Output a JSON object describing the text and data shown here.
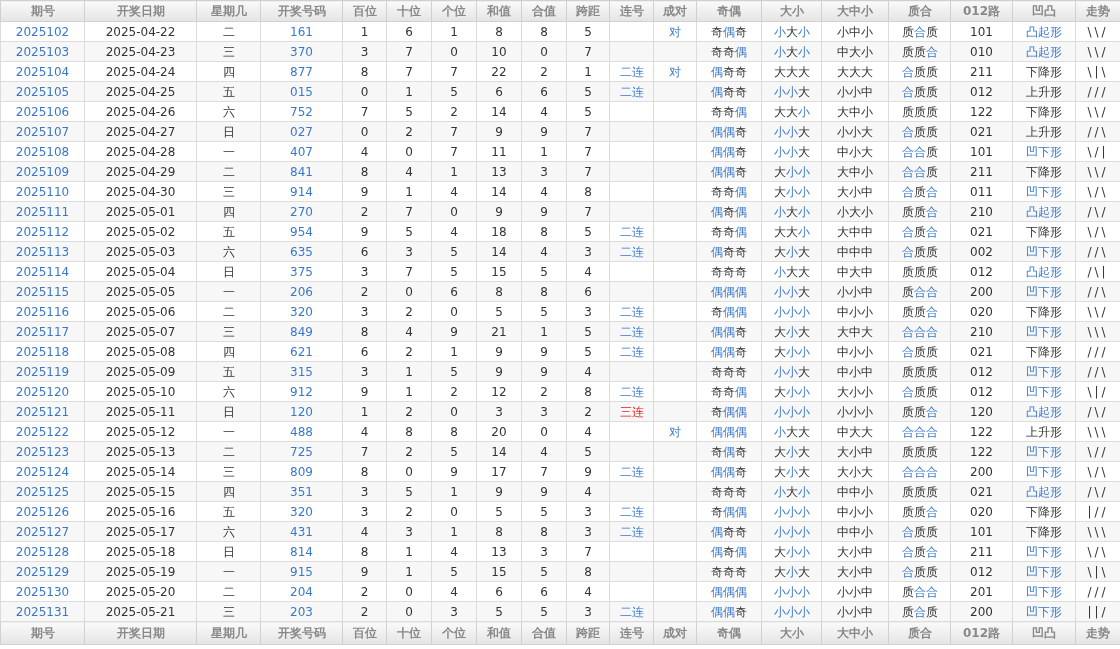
{
  "columns": [
    "期号",
    "开奖日期",
    "星期几",
    "开奖号码",
    "百位",
    "十位",
    "个位",
    "和值",
    "合值",
    "跨距",
    "连号",
    "成对",
    "奇偶",
    "大小",
    "大中小",
    "质合",
    "012路",
    "凹凸",
    "走势"
  ],
  "rows": [
    {
      "issue": "2025102",
      "date": "2025-04-22",
      "weekday": "二",
      "number": "161",
      "digits": [
        "1",
        "6",
        "1",
        "8",
        "8",
        "5"
      ],
      "pair": "对",
      "parity": "奇偶奇",
      "parity_hl": [
        false,
        true,
        false
      ],
      "size": "小大小",
      "size_hl": [
        true,
        false,
        true
      ],
      "size3": "小中小",
      "prime": "质合质",
      "prime_hl": [
        false,
        true,
        false
      ],
      "road": "101",
      "shape": "凸起形",
      "shape_hl": true,
      "trend": "\\\\/"
    },
    {
      "issue": "2025103",
      "date": "2025-04-23",
      "weekday": "三",
      "number": "370",
      "digits": [
        "3",
        "7",
        "0",
        "10",
        "0",
        "7"
      ],
      "parity": "奇奇偶",
      "parity_hl": [
        false,
        false,
        true
      ],
      "size": "小大小",
      "size_hl": [
        true,
        false,
        true
      ],
      "size3": "中大小",
      "prime": "质质合",
      "prime_hl": [
        false,
        false,
        true
      ],
      "road": "010",
      "shape": "凸起形",
      "shape_hl": true,
      "trend": "\\\\/"
    },
    {
      "issue": "2025104",
      "date": "2025-04-24",
      "weekday": "四",
      "number": "877",
      "digits": [
        "8",
        "7",
        "7",
        "22",
        "2",
        "1"
      ],
      "consec": {
        "text": "二连",
        "kind": "double"
      },
      "pair": "对",
      "parity": "偶奇奇",
      "parity_hl": [
        true,
        false,
        false
      ],
      "size": "大大大",
      "size_hl": [
        false,
        false,
        false
      ],
      "size3": "大大大",
      "prime": "合质质",
      "prime_hl": [
        true,
        false,
        false
      ],
      "road": "211",
      "shape": "下降形",
      "shape_hl": false,
      "trend": "\\|\\"
    },
    {
      "issue": "2025105",
      "date": "2025-04-25",
      "weekday": "五",
      "number": "015",
      "digits": [
        "0",
        "1",
        "5",
        "6",
        "6",
        "5"
      ],
      "consec": {
        "text": "二连",
        "kind": "double"
      },
      "parity": "偶奇奇",
      "parity_hl": [
        true,
        false,
        false
      ],
      "size": "小小大",
      "size_hl": [
        true,
        true,
        false
      ],
      "size3": "小小中",
      "prime": "合质质",
      "prime_hl": [
        true,
        false,
        false
      ],
      "road": "012",
      "shape": "上升形",
      "shape_hl": false,
      "trend": "///"
    },
    {
      "issue": "2025106",
      "date": "2025-04-26",
      "weekday": "六",
      "number": "752",
      "digits": [
        "7",
        "5",
        "2",
        "14",
        "4",
        "5"
      ],
      "parity": "奇奇偶",
      "parity_hl": [
        false,
        false,
        true
      ],
      "size": "大大小",
      "size_hl": [
        false,
        false,
        true
      ],
      "size3": "大中小",
      "prime": "质质质",
      "prime_hl": [
        false,
        false,
        false
      ],
      "road": "122",
      "shape": "下降形",
      "shape_hl": false,
      "trend": "\\\\/"
    },
    {
      "issue": "2025107",
      "date": "2025-04-27",
      "weekday": "日",
      "number": "027",
      "digits": [
        "0",
        "2",
        "7",
        "9",
        "9",
        "7"
      ],
      "parity": "偶偶奇",
      "parity_hl": [
        true,
        true,
        false
      ],
      "size": "小小大",
      "size_hl": [
        true,
        true,
        false
      ],
      "size3": "小小大",
      "prime": "合质质",
      "prime_hl": [
        true,
        false,
        false
      ],
      "road": "021",
      "shape": "上升形",
      "shape_hl": false,
      "trend": "//\\"
    },
    {
      "issue": "2025108",
      "date": "2025-04-28",
      "weekday": "一",
      "number": "407",
      "digits": [
        "4",
        "0",
        "7",
        "11",
        "1",
        "7"
      ],
      "parity": "偶偶奇",
      "parity_hl": [
        true,
        true,
        false
      ],
      "size": "小小大",
      "size_hl": [
        true,
        true,
        false
      ],
      "size3": "中小大",
      "prime": "合合质",
      "prime_hl": [
        true,
        true,
        false
      ],
      "road": "101",
      "shape": "凹下形",
      "shape_hl": true,
      "trend": "\\/|"
    },
    {
      "issue": "2025109",
      "date": "2025-04-29",
      "weekday": "二",
      "number": "841",
      "digits": [
        "8",
        "4",
        "1",
        "13",
        "3",
        "7"
      ],
      "parity": "偶偶奇",
      "parity_hl": [
        true,
        true,
        false
      ],
      "size": "大小小",
      "size_hl": [
        false,
        true,
        true
      ],
      "size3": "大中小",
      "prime": "合合质",
      "prime_hl": [
        true,
        true,
        false
      ],
      "road": "211",
      "shape": "下降形",
      "shape_hl": false,
      "trend": "\\\\/"
    },
    {
      "issue": "2025110",
      "date": "2025-04-30",
      "weekday": "三",
      "number": "914",
      "digits": [
        "9",
        "1",
        "4",
        "14",
        "4",
        "8"
      ],
      "parity": "奇奇偶",
      "parity_hl": [
        false,
        false,
        true
      ],
      "size": "大小小",
      "size_hl": [
        false,
        true,
        true
      ],
      "size3": "大小中",
      "prime": "合质合",
      "prime_hl": [
        true,
        false,
        true
      ],
      "road": "011",
      "shape": "凹下形",
      "shape_hl": true,
      "trend": "\\/\\"
    },
    {
      "issue": "2025111",
      "date": "2025-05-01",
      "weekday": "四",
      "number": "270",
      "digits": [
        "2",
        "7",
        "0",
        "9",
        "9",
        "7"
      ],
      "parity": "偶奇偶",
      "parity_hl": [
        true,
        false,
        true
      ],
      "size": "小大小",
      "size_hl": [
        true,
        false,
        true
      ],
      "size3": "小大小",
      "prime": "质质合",
      "prime_hl": [
        false,
        false,
        true
      ],
      "road": "210",
      "shape": "凸起形",
      "shape_hl": true,
      "trend": "/\\/"
    },
    {
      "issue": "2025112",
      "date": "2025-05-02",
      "weekday": "五",
      "number": "954",
      "digits": [
        "9",
        "5",
        "4",
        "18",
        "8",
        "5"
      ],
      "consec": {
        "text": "二连",
        "kind": "double"
      },
      "parity": "奇奇偶",
      "parity_hl": [
        false,
        false,
        true
      ],
      "size": "大大小",
      "size_hl": [
        false,
        false,
        true
      ],
      "size3": "大中中",
      "prime": "合质合",
      "prime_hl": [
        true,
        false,
        true
      ],
      "road": "021",
      "shape": "下降形",
      "shape_hl": false,
      "trend": "\\/\\"
    },
    {
      "issue": "2025113",
      "date": "2025-05-03",
      "weekday": "六",
      "number": "635",
      "digits": [
        "6",
        "3",
        "5",
        "14",
        "4",
        "3"
      ],
      "consec": {
        "text": "二连",
        "kind": "double"
      },
      "parity": "偶奇奇",
      "parity_hl": [
        true,
        false,
        false
      ],
      "size": "大小大",
      "size_hl": [
        false,
        true,
        false
      ],
      "size3": "中中中",
      "prime": "合质质",
      "prime_hl": [
        true,
        false,
        false
      ],
      "road": "002",
      "shape": "凹下形",
      "shape_hl": true,
      "trend": "//\\"
    },
    {
      "issue": "2025114",
      "date": "2025-05-04",
      "weekday": "日",
      "number": "375",
      "digits": [
        "3",
        "7",
        "5",
        "15",
        "5",
        "4"
      ],
      "parity": "奇奇奇",
      "parity_hl": [
        false,
        false,
        false
      ],
      "size": "小大大",
      "size_hl": [
        true,
        false,
        false
      ],
      "size3": "中大中",
      "prime": "质质质",
      "prime_hl": [
        false,
        false,
        false
      ],
      "road": "012",
      "shape": "凸起形",
      "shape_hl": true,
      "trend": "/\\|"
    },
    {
      "issue": "2025115",
      "date": "2025-05-05",
      "weekday": "一",
      "number": "206",
      "digits": [
        "2",
        "0",
        "6",
        "8",
        "8",
        "6"
      ],
      "parity": "偶偶偶",
      "parity_hl": [
        true,
        true,
        true
      ],
      "size": "小小大",
      "size_hl": [
        true,
        true,
        false
      ],
      "size3": "小小中",
      "prime": "质合合",
      "prime_hl": [
        false,
        true,
        true
      ],
      "road": "200",
      "shape": "凹下形",
      "shape_hl": true,
      "trend": "//\\"
    },
    {
      "issue": "2025116",
      "date": "2025-05-06",
      "weekday": "二",
      "number": "320",
      "digits": [
        "3",
        "2",
        "0",
        "5",
        "5",
        "3"
      ],
      "consec": {
        "text": "二连",
        "kind": "double"
      },
      "parity": "奇偶偶",
      "parity_hl": [
        false,
        true,
        true
      ],
      "size": "小小小",
      "size_hl": [
        true,
        true,
        true
      ],
      "size3": "中小小",
      "prime": "质质合",
      "prime_hl": [
        false,
        false,
        true
      ],
      "road": "020",
      "shape": "下降形",
      "shape_hl": false,
      "trend": "\\\\/"
    },
    {
      "issue": "2025117",
      "date": "2025-05-07",
      "weekday": "三",
      "number": "849",
      "digits": [
        "8",
        "4",
        "9",
        "21",
        "1",
        "5"
      ],
      "consec": {
        "text": "二连",
        "kind": "double"
      },
      "parity": "偶偶奇",
      "parity_hl": [
        true,
        true,
        false
      ],
      "size": "大小大",
      "size_hl": [
        false,
        true,
        false
      ],
      "size3": "大中大",
      "prime": "合合合",
      "prime_hl": [
        true,
        true,
        true
      ],
      "road": "210",
      "shape": "凹下形",
      "shape_hl": true,
      "trend": "\\\\\\"
    },
    {
      "issue": "2025118",
      "date": "2025-05-08",
      "weekday": "四",
      "number": "621",
      "digits": [
        "6",
        "2",
        "1",
        "9",
        "9",
        "5"
      ],
      "consec": {
        "text": "二连",
        "kind": "double"
      },
      "parity": "偶偶奇",
      "parity_hl": [
        true,
        true,
        false
      ],
      "size": "大小小",
      "size_hl": [
        false,
        true,
        true
      ],
      "size3": "中小小",
      "prime": "合质质",
      "prime_hl": [
        true,
        false,
        false
      ],
      "road": "021",
      "shape": "下降形",
      "shape_hl": false,
      "trend": "///"
    },
    {
      "issue": "2025119",
      "date": "2025-05-09",
      "weekday": "五",
      "number": "315",
      "digits": [
        "3",
        "1",
        "5",
        "9",
        "9",
        "4"
      ],
      "parity": "奇奇奇",
      "parity_hl": [
        false,
        false,
        false
      ],
      "size": "小小大",
      "size_hl": [
        true,
        true,
        false
      ],
      "size3": "中小中",
      "prime": "质质质",
      "prime_hl": [
        false,
        false,
        false
      ],
      "road": "012",
      "shape": "凹下形",
      "shape_hl": true,
      "trend": "//\\"
    },
    {
      "issue": "2025120",
      "date": "2025-05-10",
      "weekday": "六",
      "number": "912",
      "digits": [
        "9",
        "1",
        "2",
        "12",
        "2",
        "8"
      ],
      "consec": {
        "text": "二连",
        "kind": "double"
      },
      "parity": "奇奇偶",
      "parity_hl": [
        false,
        false,
        true
      ],
      "size": "大小小",
      "size_hl": [
        false,
        true,
        true
      ],
      "size3": "大小小",
      "prime": "合质质",
      "prime_hl": [
        true,
        false,
        false
      ],
      "road": "012",
      "shape": "凹下形",
      "shape_hl": true,
      "trend": "\\|/"
    },
    {
      "issue": "2025121",
      "date": "2025-05-11",
      "weekday": "日",
      "number": "120",
      "digits": [
        "1",
        "2",
        "0",
        "3",
        "3",
        "2"
      ],
      "consec": {
        "text": "三连",
        "kind": "triple"
      },
      "parity": "奇偶偶",
      "parity_hl": [
        false,
        true,
        true
      ],
      "size": "小小小",
      "size_hl": [
        true,
        true,
        true
      ],
      "size3": "小小小",
      "prime": "质质合",
      "prime_hl": [
        false,
        false,
        true
      ],
      "road": "120",
      "shape": "凸起形",
      "shape_hl": true,
      "trend": "/\\/"
    },
    {
      "issue": "2025122",
      "date": "2025-05-12",
      "weekday": "一",
      "number": "488",
      "digits": [
        "4",
        "8",
        "8",
        "20",
        "0",
        "4"
      ],
      "pair": "对",
      "parity": "偶偶偶",
      "parity_hl": [
        true,
        true,
        true
      ],
      "size": "小大大",
      "size_hl": [
        true,
        false,
        false
      ],
      "size3": "中大大",
      "prime": "合合合",
      "prime_hl": [
        true,
        true,
        true
      ],
      "road": "122",
      "shape": "上升形",
      "shape_hl": false,
      "trend": "\\\\\\"
    },
    {
      "issue": "2025123",
      "date": "2025-05-13",
      "weekday": "二",
      "number": "725",
      "digits": [
        "7",
        "2",
        "5",
        "14",
        "4",
        "5"
      ],
      "parity": "奇偶奇",
      "parity_hl": [
        false,
        true,
        false
      ],
      "size": "大小大",
      "size_hl": [
        false,
        true,
        false
      ],
      "size3": "大小中",
      "prime": "质质质",
      "prime_hl": [
        false,
        false,
        false
      ],
      "road": "122",
      "shape": "凹下形",
      "shape_hl": true,
      "trend": "\\//"
    },
    {
      "issue": "2025124",
      "date": "2025-05-14",
      "weekday": "三",
      "number": "809",
      "digits": [
        "8",
        "0",
        "9",
        "17",
        "7",
        "9"
      ],
      "consec": {
        "text": "二连",
        "kind": "double"
      },
      "parity": "偶偶奇",
      "parity_hl": [
        true,
        true,
        false
      ],
      "size": "大小大",
      "size_hl": [
        false,
        true,
        false
      ],
      "size3": "大小大",
      "prime": "合合合",
      "prime_hl": [
        true,
        true,
        true
      ],
      "road": "200",
      "shape": "凹下形",
      "shape_hl": true,
      "trend": "\\/\\"
    },
    {
      "issue": "2025125",
      "date": "2025-05-15",
      "weekday": "四",
      "number": "351",
      "digits": [
        "3",
        "5",
        "1",
        "9",
        "9",
        "4"
      ],
      "parity": "奇奇奇",
      "parity_hl": [
        false,
        false,
        false
      ],
      "size": "小大小",
      "size_hl": [
        true,
        false,
        true
      ],
      "size3": "中中小",
      "prime": "质质质",
      "prime_hl": [
        false,
        false,
        false
      ],
      "road": "021",
      "shape": "凸起形",
      "shape_hl": true,
      "trend": "/\\/"
    },
    {
      "issue": "2025126",
      "date": "2025-05-16",
      "weekday": "五",
      "number": "320",
      "digits": [
        "3",
        "2",
        "0",
        "5",
        "5",
        "3"
      ],
      "consec": {
        "text": "二连",
        "kind": "double"
      },
      "parity": "奇偶偶",
      "parity_hl": [
        false,
        true,
        true
      ],
      "size": "小小小",
      "size_hl": [
        true,
        true,
        true
      ],
      "size3": "中小小",
      "prime": "质质合",
      "prime_hl": [
        false,
        false,
        true
      ],
      "road": "020",
      "shape": "下降形",
      "shape_hl": false,
      "trend": "|//"
    },
    {
      "issue": "2025127",
      "date": "2025-05-17",
      "weekday": "六",
      "number": "431",
      "digits": [
        "4",
        "3",
        "1",
        "8",
        "8",
        "3"
      ],
      "consec": {
        "text": "二连",
        "kind": "double"
      },
      "parity": "偶奇奇",
      "parity_hl": [
        true,
        false,
        false
      ],
      "size": "小小小",
      "size_hl": [
        true,
        true,
        true
      ],
      "size3": "中中小",
      "prime": "合质质",
      "prime_hl": [
        true,
        false,
        false
      ],
      "road": "101",
      "shape": "下降形",
      "shape_hl": false,
      "trend": "\\\\\\"
    },
    {
      "issue": "2025128",
      "date": "2025-05-18",
      "weekday": "日",
      "number": "814",
      "digits": [
        "8",
        "1",
        "4",
        "13",
        "3",
        "7"
      ],
      "parity": "偶奇偶",
      "parity_hl": [
        true,
        false,
        true
      ],
      "size": "大小小",
      "size_hl": [
        false,
        true,
        true
      ],
      "size3": "大小中",
      "prime": "合质合",
      "prime_hl": [
        true,
        false,
        true
      ],
      "road": "211",
      "shape": "凹下形",
      "shape_hl": true,
      "trend": "\\/\\"
    },
    {
      "issue": "2025129",
      "date": "2025-05-19",
      "weekday": "一",
      "number": "915",
      "digits": [
        "9",
        "1",
        "5",
        "15",
        "5",
        "8"
      ],
      "parity": "奇奇奇",
      "parity_hl": [
        false,
        false,
        false
      ],
      "size": "大小大",
      "size_hl": [
        false,
        true,
        false
      ],
      "size3": "大小中",
      "prime": "合质质",
      "prime_hl": [
        true,
        false,
        false
      ],
      "road": "012",
      "shape": "凹下形",
      "shape_hl": true,
      "trend": "\\|\\"
    },
    {
      "issue": "2025130",
      "date": "2025-05-20",
      "weekday": "二",
      "number": "204",
      "digits": [
        "2",
        "0",
        "4",
        "6",
        "6",
        "4"
      ],
      "parity": "偶偶偶",
      "parity_hl": [
        true,
        true,
        true
      ],
      "size": "小小小",
      "size_hl": [
        true,
        true,
        true
      ],
      "size3": "小小中",
      "prime": "质合合",
      "prime_hl": [
        false,
        true,
        true
      ],
      "road": "201",
      "shape": "凹下形",
      "shape_hl": true,
      "trend": "///"
    },
    {
      "issue": "2025131",
      "date": "2025-05-21",
      "weekday": "三",
      "number": "203",
      "digits": [
        "2",
        "0",
        "3",
        "5",
        "5",
        "3"
      ],
      "consec": {
        "text": "二连",
        "kind": "double"
      },
      "parity": "偶偶奇",
      "parity_hl": [
        true,
        true,
        false
      ],
      "size": "小小小",
      "size_hl": [
        true,
        true,
        true
      ],
      "size3": "小小中",
      "prime": "质合质",
      "prime_hl": [
        false,
        true,
        false
      ],
      "road": "200",
      "shape": "凹下形",
      "shape_hl": true,
      "trend": "||/"
    }
  ],
  "footer_columns": [
    "期号",
    "开奖日期",
    "星期几",
    "开奖号码",
    "百位",
    "十位",
    "个位",
    "和值",
    "合值",
    "跨距",
    "连号",
    "成对",
    "奇偶",
    "大小",
    "大中小",
    "质合",
    "012路",
    "凹凸",
    "走势"
  ]
}
